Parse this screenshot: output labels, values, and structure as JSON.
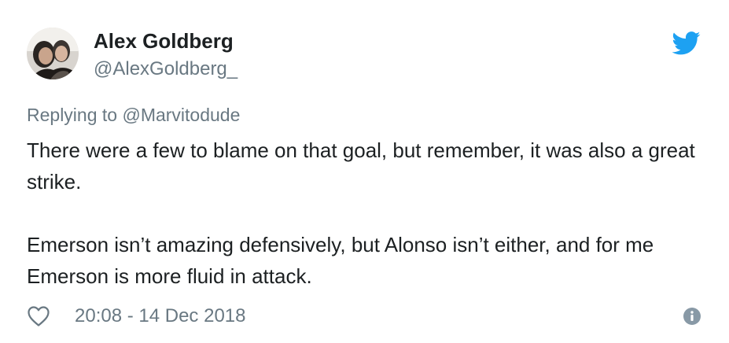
{
  "author": {
    "name": "Alex Goldberg",
    "handle": "@AlexGoldberg_",
    "avatar_icon": "avatar-photo"
  },
  "reply": {
    "prefix": "Replying to",
    "target": "@Marvitodude"
  },
  "tweet": {
    "paragraphs": [
      "There were a few to blame on that goal, but remember, it was also a great strike.",
      "Emerson isn’t amazing defensively, but Alonso isn’t either, and for me Emerson is more fluid in attack."
    ]
  },
  "footer": {
    "timestamp": "20:08 - 14 Dec 2018",
    "like_icon": "heart-outline-icon",
    "info_icon": "info-icon"
  },
  "brand": {
    "logo_icon": "twitter-bird-icon",
    "accent_color": "#1da1f2"
  }
}
